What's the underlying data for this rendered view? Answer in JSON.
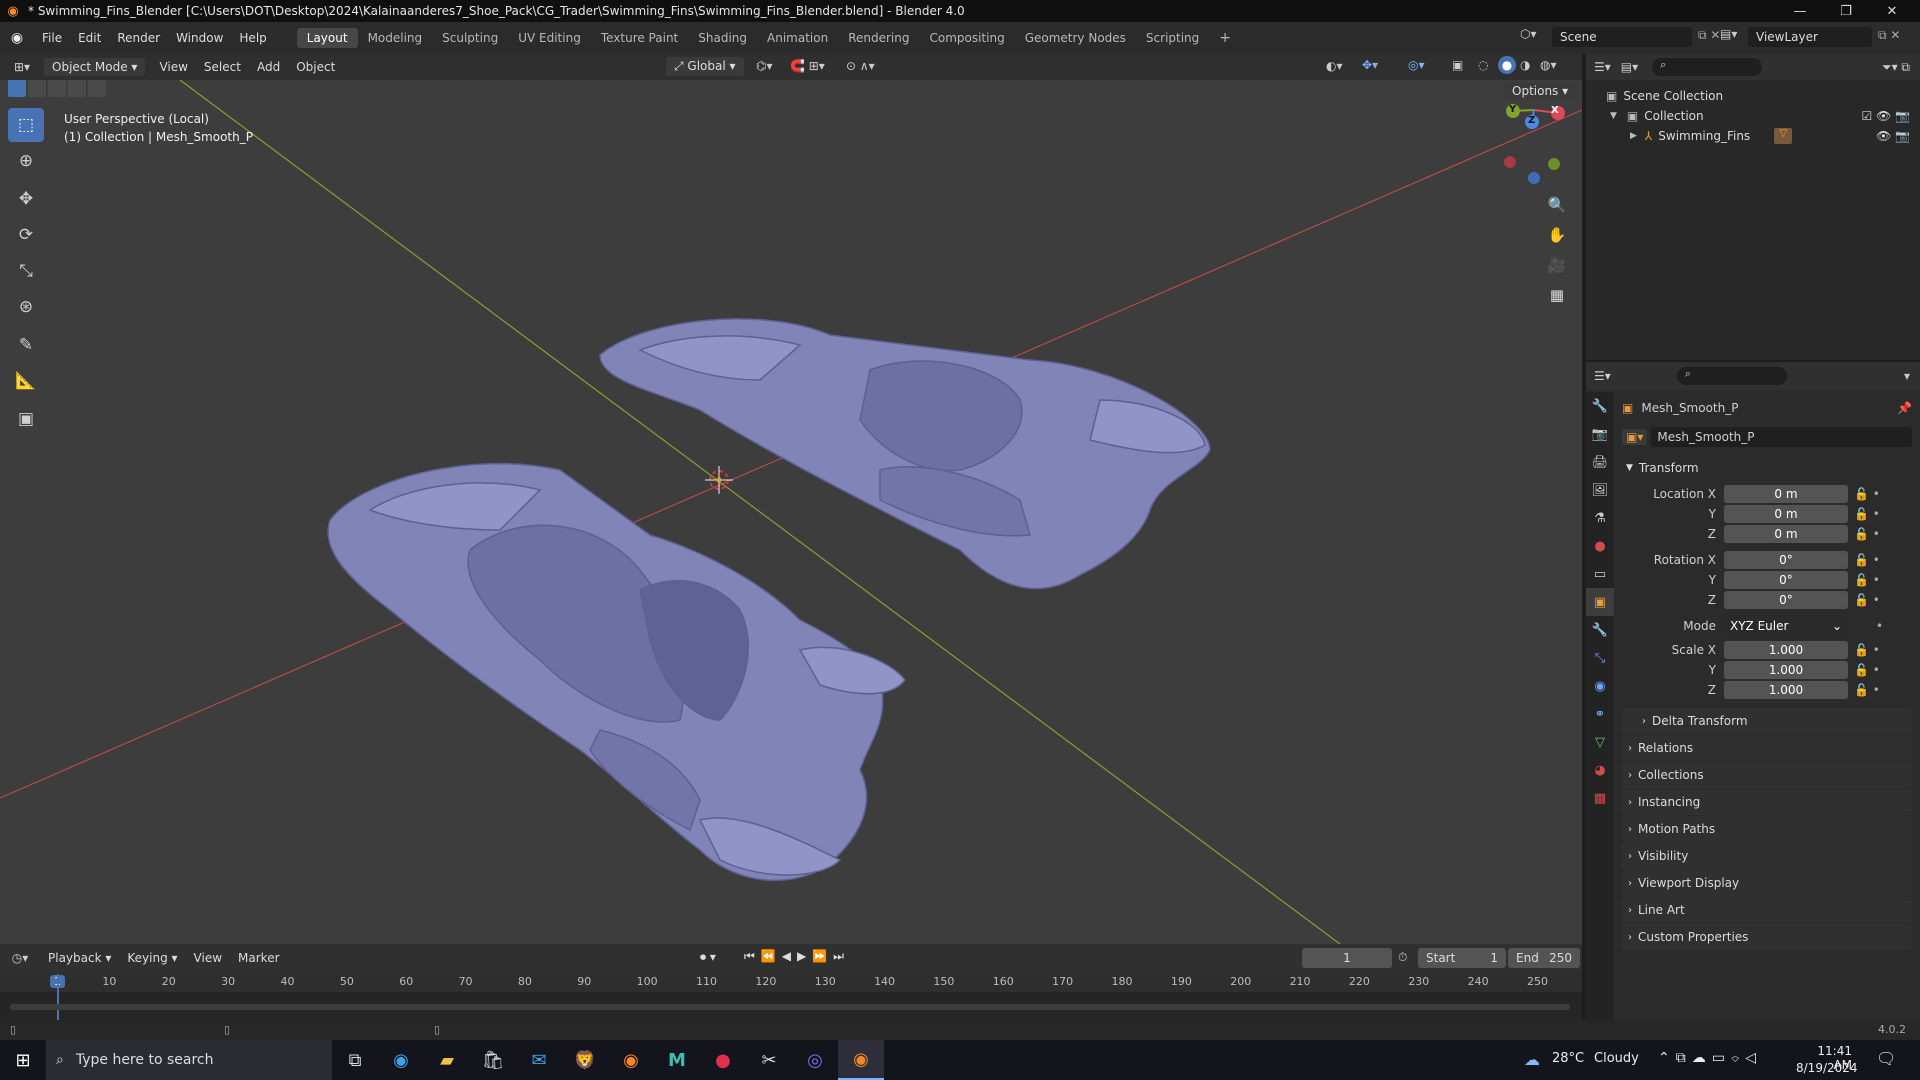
{
  "window": {
    "title": "* Swimming_Fins_Blender [C:\\Users\\DOT\\Desktop\\2024\\Kalainaanderes7_Shoe_Pack\\CG_Trader\\Swimming_Fins\\Swimming_Fins_Blender.blend] - Blender 4.0"
  },
  "menu": [
    "File",
    "Edit",
    "Render",
    "Window",
    "Help"
  ],
  "workspaces": [
    "Layout",
    "Modeling",
    "Sculpting",
    "UV Editing",
    "Texture Paint",
    "Shading",
    "Animation",
    "Rendering",
    "Compositing",
    "Geometry Nodes",
    "Scripting"
  ],
  "active_workspace": "Layout",
  "scene": {
    "name": "Scene",
    "view_layer": "ViewLayer"
  },
  "viewport_header": {
    "mode": "Object Mode",
    "menus": [
      "View",
      "Select",
      "Add",
      "Object"
    ],
    "orientation": "Global",
    "options": "Options"
  },
  "viewport": {
    "info_line1": "User Perspective (Local)",
    "info_line2": "(1) Collection | Mesh_Smooth_P",
    "gizmo": {
      "x": "X",
      "y": "Y",
      "z": "Z"
    },
    "mesh_color": "#8084b6",
    "x_axis_color": "#b54a4a",
    "y_axis_color": "#7ea52c"
  },
  "outliner": {
    "scene_collection": "Scene Collection",
    "collection": "Collection",
    "object": "Swimming_Fins"
  },
  "properties": {
    "object_name": "Mesh_Smooth_P",
    "datablock_name": "Mesh_Smooth_P",
    "transform_label": "Transform",
    "location_label": "Location X",
    "rotation_label": "Rotation X",
    "scale_label": "Scale X",
    "y_label": "Y",
    "z_label": "Z",
    "location": [
      "0 m",
      "0 m",
      "0 m"
    ],
    "rotation": [
      "0°",
      "0°",
      "0°"
    ],
    "mode_label": "Mode",
    "mode": "XYZ Euler",
    "scale": [
      "1.000",
      "1.000",
      "1.000"
    ],
    "delta_transform": "Delta Transform",
    "subpanels": [
      "Relations",
      "Collections",
      "Instancing",
      "Motion Paths",
      "Visibility",
      "Viewport Display",
      "Line Art",
      "Custom Properties"
    ]
  },
  "timeline": {
    "menus": [
      "Playback",
      "Keying",
      "View",
      "Marker"
    ],
    "current_frame": "1",
    "start_label": "Start",
    "start": "1",
    "end_label": "End",
    "end": "250",
    "ticks": [
      "1",
      "10",
      "20",
      "30",
      "40",
      "50",
      "60",
      "70",
      "80",
      "90",
      "100",
      "110",
      "120",
      "130",
      "140",
      "150",
      "160",
      "170",
      "180",
      "190",
      "200",
      "210",
      "220",
      "230",
      "240",
      "250"
    ]
  },
  "status": {
    "version": "4.0.2"
  },
  "taskbar": {
    "search_placeholder": "Type here to search",
    "weather_temp": "28°C",
    "weather_text": "Cloudy",
    "time": "11:41 AM",
    "date": "8/19/2024"
  }
}
